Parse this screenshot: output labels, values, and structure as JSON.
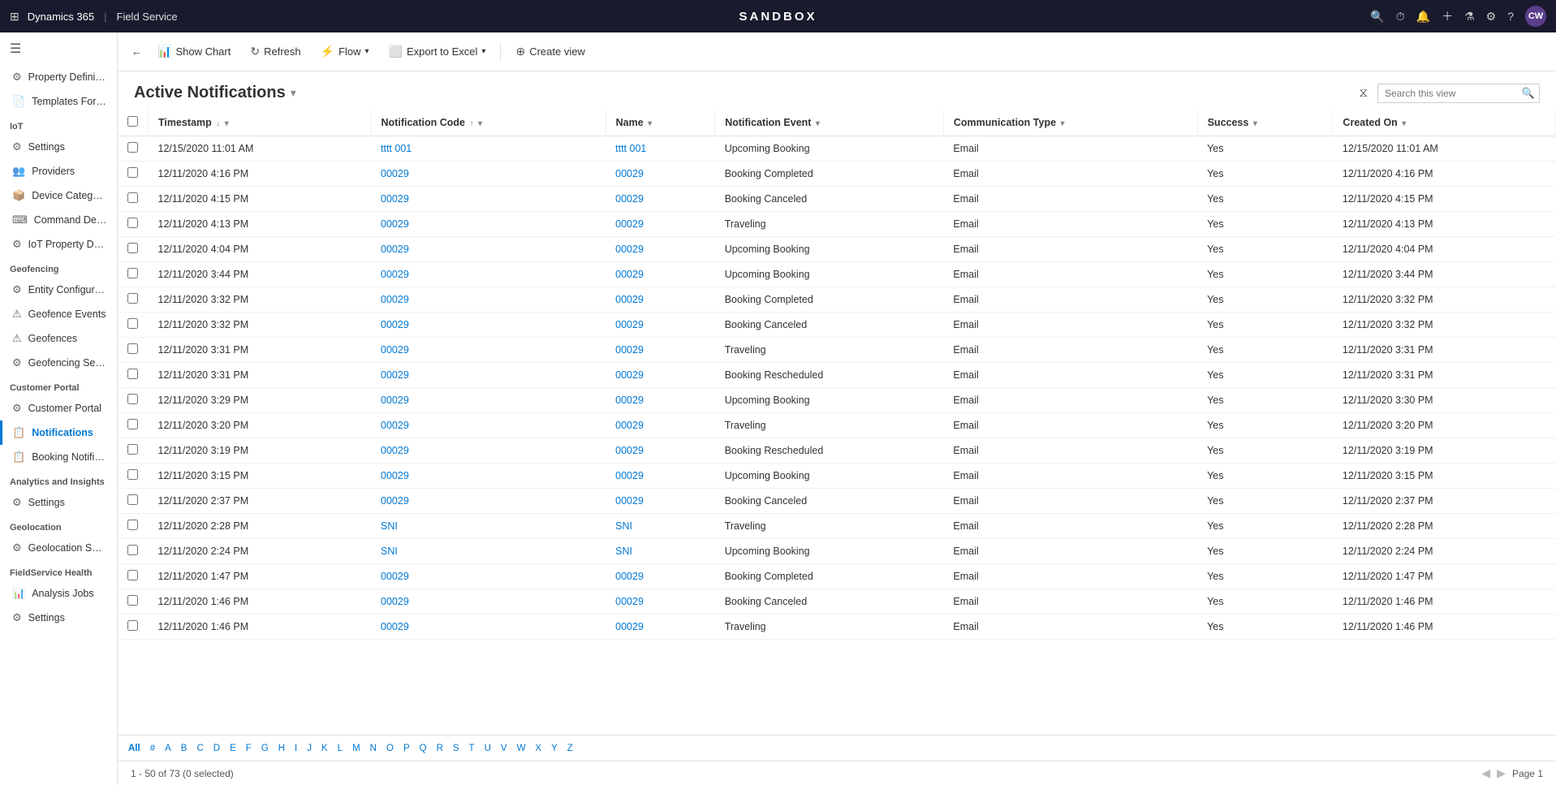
{
  "topbar": {
    "app_name": "Dynamics 365",
    "module_name": "Field Service",
    "title": "SANDBOX",
    "avatar": "CW"
  },
  "toolbar": {
    "show_chart": "Show Chart",
    "refresh": "Refresh",
    "flow": "Flow",
    "export_to_excel": "Export to Excel",
    "create_view": "Create view"
  },
  "page": {
    "title": "Active Notifications",
    "search_placeholder": "Search this view"
  },
  "columns": [
    {
      "id": "timestamp",
      "label": "Timestamp",
      "sortable": true,
      "sort_dir": "desc",
      "filterable": true
    },
    {
      "id": "notification_code",
      "label": "Notification Code",
      "sortable": true,
      "sort_dir": "asc",
      "filterable": true
    },
    {
      "id": "name",
      "label": "Name",
      "sortable": true,
      "filterable": true
    },
    {
      "id": "notification_event",
      "label": "Notification Event",
      "sortable": true,
      "filterable": true
    },
    {
      "id": "communication_type",
      "label": "Communication Type",
      "sortable": true,
      "filterable": true
    },
    {
      "id": "success",
      "label": "Success",
      "sortable": true,
      "filterable": true
    },
    {
      "id": "created_on",
      "label": "Created On",
      "sortable": true,
      "filterable": true
    }
  ],
  "rows": [
    {
      "timestamp": "12/15/2020 11:01 AM",
      "notification_code": "tttt 001",
      "name": "tttt 001",
      "notification_event": "Upcoming Booking",
      "communication_type": "Email",
      "success": "Yes",
      "created_on": "12/15/2020 11:01 AM"
    },
    {
      "timestamp": "12/11/2020 4:16 PM",
      "notification_code": "00029",
      "name": "00029",
      "notification_event": "Booking Completed",
      "communication_type": "Email",
      "success": "Yes",
      "created_on": "12/11/2020 4:16 PM"
    },
    {
      "timestamp": "12/11/2020 4:15 PM",
      "notification_code": "00029",
      "name": "00029",
      "notification_event": "Booking Canceled",
      "communication_type": "Email",
      "success": "Yes",
      "created_on": "12/11/2020 4:15 PM"
    },
    {
      "timestamp": "12/11/2020 4:13 PM",
      "notification_code": "00029",
      "name": "00029",
      "notification_event": "Traveling",
      "communication_type": "Email",
      "success": "Yes",
      "created_on": "12/11/2020 4:13 PM"
    },
    {
      "timestamp": "12/11/2020 4:04 PM",
      "notification_code": "00029",
      "name": "00029",
      "notification_event": "Upcoming Booking",
      "communication_type": "Email",
      "success": "Yes",
      "created_on": "12/11/2020 4:04 PM"
    },
    {
      "timestamp": "12/11/2020 3:44 PM",
      "notification_code": "00029",
      "name": "00029",
      "notification_event": "Upcoming Booking",
      "communication_type": "Email",
      "success": "Yes",
      "created_on": "12/11/2020 3:44 PM"
    },
    {
      "timestamp": "12/11/2020 3:32 PM",
      "notification_code": "00029",
      "name": "00029",
      "notification_event": "Booking Completed",
      "communication_type": "Email",
      "success": "Yes",
      "created_on": "12/11/2020 3:32 PM"
    },
    {
      "timestamp": "12/11/2020 3:32 PM",
      "notification_code": "00029",
      "name": "00029",
      "notification_event": "Booking Canceled",
      "communication_type": "Email",
      "success": "Yes",
      "created_on": "12/11/2020 3:32 PM"
    },
    {
      "timestamp": "12/11/2020 3:31 PM",
      "notification_code": "00029",
      "name": "00029",
      "notification_event": "Traveling",
      "communication_type": "Email",
      "success": "Yes",
      "created_on": "12/11/2020 3:31 PM"
    },
    {
      "timestamp": "12/11/2020 3:31 PM",
      "notification_code": "00029",
      "name": "00029",
      "notification_event": "Booking Rescheduled",
      "communication_type": "Email",
      "success": "Yes",
      "created_on": "12/11/2020 3:31 PM"
    },
    {
      "timestamp": "12/11/2020 3:29 PM",
      "notification_code": "00029",
      "name": "00029",
      "notification_event": "Upcoming Booking",
      "communication_type": "Email",
      "success": "Yes",
      "created_on": "12/11/2020 3:30 PM"
    },
    {
      "timestamp": "12/11/2020 3:20 PM",
      "notification_code": "00029",
      "name": "00029",
      "notification_event": "Traveling",
      "communication_type": "Email",
      "success": "Yes",
      "created_on": "12/11/2020 3:20 PM"
    },
    {
      "timestamp": "12/11/2020 3:19 PM",
      "notification_code": "00029",
      "name": "00029",
      "notification_event": "Booking Rescheduled",
      "communication_type": "Email",
      "success": "Yes",
      "created_on": "12/11/2020 3:19 PM"
    },
    {
      "timestamp": "12/11/2020 3:15 PM",
      "notification_code": "00029",
      "name": "00029",
      "notification_event": "Upcoming Booking",
      "communication_type": "Email",
      "success": "Yes",
      "created_on": "12/11/2020 3:15 PM"
    },
    {
      "timestamp": "12/11/2020 2:37 PM",
      "notification_code": "00029",
      "name": "00029",
      "notification_event": "Booking Canceled",
      "communication_type": "Email",
      "success": "Yes",
      "created_on": "12/11/2020 2:37 PM"
    },
    {
      "timestamp": "12/11/2020 2:28 PM",
      "notification_code": "SNI",
      "name": "SNI",
      "notification_event": "Traveling",
      "communication_type": "Email",
      "success": "Yes",
      "created_on": "12/11/2020 2:28 PM"
    },
    {
      "timestamp": "12/11/2020 2:24 PM",
      "notification_code": "SNI",
      "name": "SNI",
      "notification_event": "Upcoming Booking",
      "communication_type": "Email",
      "success": "Yes",
      "created_on": "12/11/2020 2:24 PM"
    },
    {
      "timestamp": "12/11/2020 1:47 PM",
      "notification_code": "00029",
      "name": "00029",
      "notification_event": "Booking Completed",
      "communication_type": "Email",
      "success": "Yes",
      "created_on": "12/11/2020 1:47 PM"
    },
    {
      "timestamp": "12/11/2020 1:46 PM",
      "notification_code": "00029",
      "name": "00029",
      "notification_event": "Booking Canceled",
      "communication_type": "Email",
      "success": "Yes",
      "created_on": "12/11/2020 1:46 PM"
    },
    {
      "timestamp": "12/11/2020 1:46 PM",
      "notification_code": "00029",
      "name": "00029",
      "notification_event": "Traveling",
      "communication_type": "Email",
      "success": "Yes",
      "created_on": "12/11/2020 1:46 PM"
    }
  ],
  "sidebar": {
    "sections": [
      {
        "label": "",
        "items": [
          {
            "id": "property-def",
            "label": "Property Definiti...",
            "icon": "⚙"
          },
          {
            "id": "templates",
            "label": "Templates For Pro...",
            "icon": "📄"
          }
        ]
      },
      {
        "label": "IoT",
        "items": [
          {
            "id": "settings",
            "label": "Settings",
            "icon": "⚙"
          },
          {
            "id": "providers",
            "label": "Providers",
            "icon": "👥"
          },
          {
            "id": "device-categories",
            "label": "Device Categories",
            "icon": "📦"
          },
          {
            "id": "command-def",
            "label": "Command Definiti...",
            "icon": "⌨"
          },
          {
            "id": "iot-property",
            "label": "IoT Property Defi...",
            "icon": "⚙"
          }
        ]
      },
      {
        "label": "Geofencing",
        "items": [
          {
            "id": "entity-config",
            "label": "Entity Configurati...",
            "icon": "⚙"
          },
          {
            "id": "geofence-events",
            "label": "Geofence Events",
            "icon": "⚠"
          },
          {
            "id": "geofences",
            "label": "Geofences",
            "icon": "⚠"
          },
          {
            "id": "geofencing-settings",
            "label": "Geofencing Settin...",
            "icon": "⚙"
          }
        ]
      },
      {
        "label": "Customer Portal",
        "items": [
          {
            "id": "customer-portal",
            "label": "Customer Portal",
            "icon": "⚙"
          },
          {
            "id": "notifications",
            "label": "Notifications",
            "icon": "📋",
            "active": true
          },
          {
            "id": "booking-notif",
            "label": "Booking Notificati...",
            "icon": "📋"
          }
        ]
      },
      {
        "label": "Analytics and Insights",
        "items": [
          {
            "id": "analytics-settings",
            "label": "Settings",
            "icon": "⚙"
          }
        ]
      },
      {
        "label": "Geolocation",
        "items": [
          {
            "id": "geolocation-settings",
            "label": "Geolocation Setti...",
            "icon": "⚙"
          }
        ]
      },
      {
        "label": "FieldService Health",
        "items": [
          {
            "id": "analysis-jobs",
            "label": "Analysis Jobs",
            "icon": "📊"
          }
        ]
      },
      {
        "label": "",
        "items": [
          {
            "id": "settings-bottom",
            "label": "Settings",
            "icon": "⚙"
          }
        ]
      }
    ]
  },
  "alpha_bar": [
    "All",
    "#",
    "A",
    "B",
    "C",
    "D",
    "E",
    "F",
    "G",
    "H",
    "I",
    "J",
    "K",
    "L",
    "M",
    "N",
    "O",
    "P",
    "Q",
    "R",
    "S",
    "T",
    "U",
    "V",
    "W",
    "X",
    "Y",
    "Z"
  ],
  "footer": {
    "record_count": "1 - 50 of 73 (0 selected)",
    "page_label": "Page 1"
  }
}
